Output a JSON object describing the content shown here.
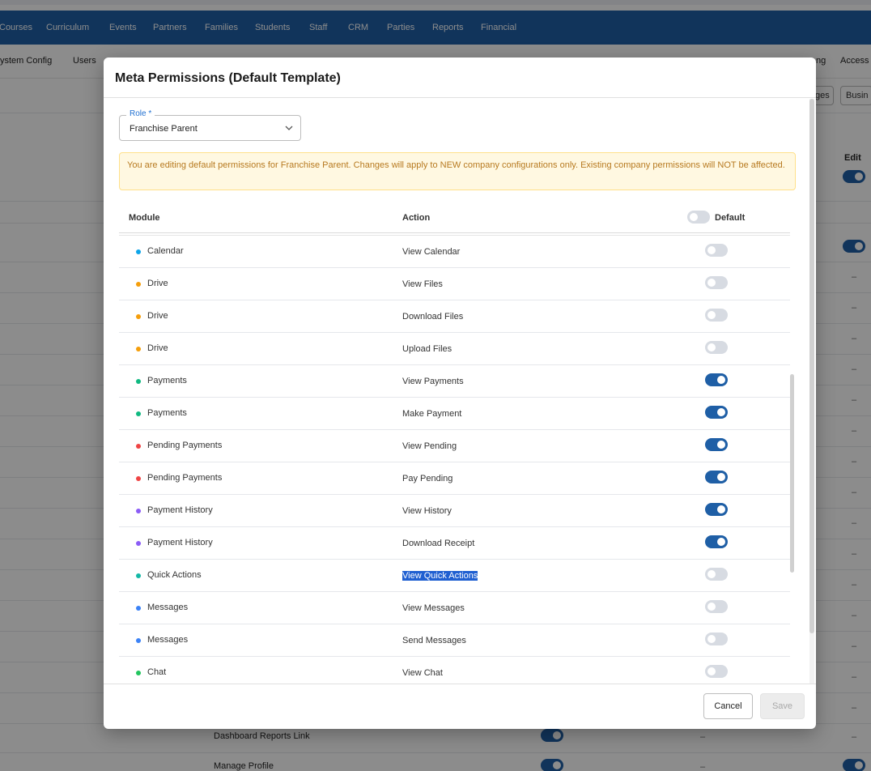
{
  "app": {
    "nav_items": [
      "Courses",
      "Curriculum",
      "Events",
      "Partners",
      "Families",
      "Students",
      "Staff",
      "CRM",
      "Parties",
      "Reports",
      "Financial"
    ],
    "subnav_left": [
      "ystem Config",
      "Users"
    ],
    "subnav_right": [
      "ng",
      "Access"
    ],
    "toolbar_buttons": [
      "ges",
      "Busin"
    ],
    "edit_label": "Edit",
    "dash": "–",
    "bg_rows": [
      "Dashboard Reports Link",
      "Manage Profile"
    ]
  },
  "modal": {
    "title": "Meta Permissions (Default Template)",
    "role": {
      "label": "Role *",
      "value": "Franchise Parent"
    },
    "alert": "You are editing default permissions for Franchise Parent. Changes will apply to NEW company configurations only. Existing company permissions will NOT be affected.",
    "table": {
      "headers": {
        "module": "Module",
        "action": "Action",
        "default": "Default"
      },
      "default_toggle_on": false,
      "rows": [
        {
          "module": "Calendar",
          "action": "View Calendar",
          "enabled": false,
          "color": "#0ea5e9"
        },
        {
          "module": "Drive",
          "action": "View Files",
          "enabled": false,
          "color": "#f59e0b"
        },
        {
          "module": "Drive",
          "action": "Download Files",
          "enabled": false,
          "color": "#f59e0b"
        },
        {
          "module": "Drive",
          "action": "Upload Files",
          "enabled": false,
          "color": "#f59e0b"
        },
        {
          "module": "Payments",
          "action": "View Payments",
          "enabled": true,
          "color": "#10b981"
        },
        {
          "module": "Payments",
          "action": "Make Payment",
          "enabled": true,
          "color": "#10b981"
        },
        {
          "module": "Pending Payments",
          "action": "View Pending",
          "enabled": true,
          "color": "#ef4444"
        },
        {
          "module": "Pending Payments",
          "action": "Pay Pending",
          "enabled": true,
          "color": "#ef4444"
        },
        {
          "module": "Payment History",
          "action": "View History",
          "enabled": true,
          "color": "#8b5cf6"
        },
        {
          "module": "Payment History",
          "action": "Download Receipt",
          "enabled": true,
          "color": "#8b5cf6"
        },
        {
          "module": "Quick Actions",
          "action": "View Quick Actions",
          "enabled": false,
          "color": "#14b8a6",
          "selected": true
        },
        {
          "module": "Messages",
          "action": "View Messages",
          "enabled": false,
          "color": "#3b82f6"
        },
        {
          "module": "Messages",
          "action": "Send Messages",
          "enabled": false,
          "color": "#3b82f6"
        },
        {
          "module": "Chat",
          "action": "View Chat",
          "enabled": false,
          "color": "#22c55e"
        }
      ]
    },
    "buttons": {
      "cancel": "Cancel",
      "save": "Save"
    }
  }
}
